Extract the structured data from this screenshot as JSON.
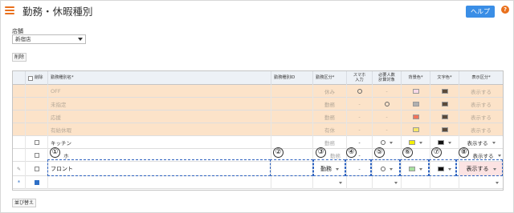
{
  "header": {
    "title": "勤務・休暇種別",
    "help_label": "ヘルプ",
    "qmark": "?"
  },
  "store": {
    "label": "店舗",
    "value": "新宿店"
  },
  "toolbar": {
    "delete_label": "削除",
    "sort_label": "並び替え"
  },
  "columns": {
    "delete": "削除",
    "name": "勤務種別名*",
    "id": "勤務種別ID",
    "kubun": "勤務区分*",
    "smart": "スマホ\n入力",
    "count": "必要人数\n計算対象",
    "bg": "背景色*",
    "text": "文字色*",
    "display": "表示区分*"
  },
  "fixed_rows": [
    {
      "name": "OFF",
      "kubun": "休み",
      "smart": "circle",
      "count": "-",
      "bg": "#f8d9e6",
      "text": "#5a4a3a",
      "display": "表示する"
    },
    {
      "name": "未指定",
      "kubun": "勤務",
      "smart": "-",
      "count": "circle",
      "bg": "#b0b0b0",
      "text": "#5a4a3a",
      "display": "表示する"
    },
    {
      "name": "応援",
      "kubun": "勤務",
      "smart": "-",
      "count": "-",
      "bg": "#f2735a",
      "text": "#5a4a3a",
      "display": "表示する"
    },
    {
      "name": "有給休暇",
      "kubun": "有休",
      "smart": "-",
      "count": "-",
      "bg": "#f7e66a",
      "text": "#5a4a3a",
      "display": "表示する"
    }
  ],
  "rows": [
    {
      "name": "キッチン",
      "kubun": "勤務",
      "smart": "-",
      "count": "circle",
      "bg": "#f4f000",
      "text": "#111111",
      "display": "表示する"
    },
    {
      "name": "ホ",
      "kubun": "勤務",
      "smart": "-",
      "count": "circle",
      "bg": "#ffffff",
      "text": "#111111",
      "display": "表示する"
    }
  ],
  "edit_row": {
    "name": "フロント",
    "kubun": "勤務",
    "smart": "-",
    "count": "circle",
    "bg": "#a8e0a0",
    "text": "#111111",
    "display": "表示する"
  },
  "markers": [
    "①",
    "②",
    "③",
    "④",
    "⑤",
    "⑥",
    "⑦",
    "⑧"
  ],
  "colors": {
    "accent": "#e9701c",
    "primary": "#3a8ee6",
    "marker_blue": "#2e63c0",
    "fixed_row_bg": "#fce3c9"
  }
}
